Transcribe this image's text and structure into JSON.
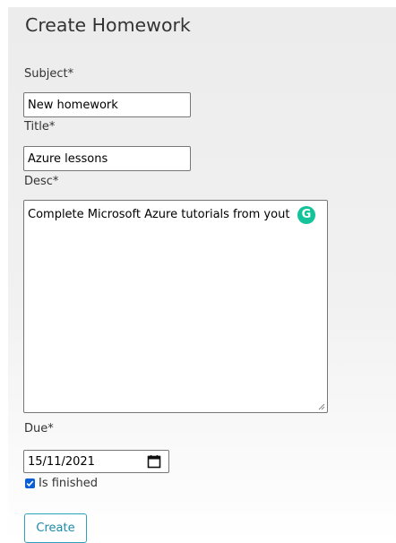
{
  "page": {
    "title": "Create Homework"
  },
  "form": {
    "subject": {
      "label": "Subject*",
      "value": "New homework"
    },
    "title": {
      "label": "Title*",
      "value": "Azure lessons"
    },
    "desc": {
      "label": "Desc*",
      "value": "Complete Microsoft Azure tutorials from yout"
    },
    "due": {
      "label": "Due*",
      "value": "15/11/2021"
    },
    "is_finished": {
      "label": "Is finished",
      "checked": true
    },
    "submit_label": "Create"
  },
  "icons": {
    "grammarly": "grammarly-icon",
    "calendar": "calendar-icon",
    "checkbox_check": "checkmark-icon",
    "resize": "resize-handle-icon"
  },
  "colors": {
    "accent": "#2aa3bb",
    "checkbox": "#0a5ed7",
    "grammarly": "#15c39a"
  }
}
